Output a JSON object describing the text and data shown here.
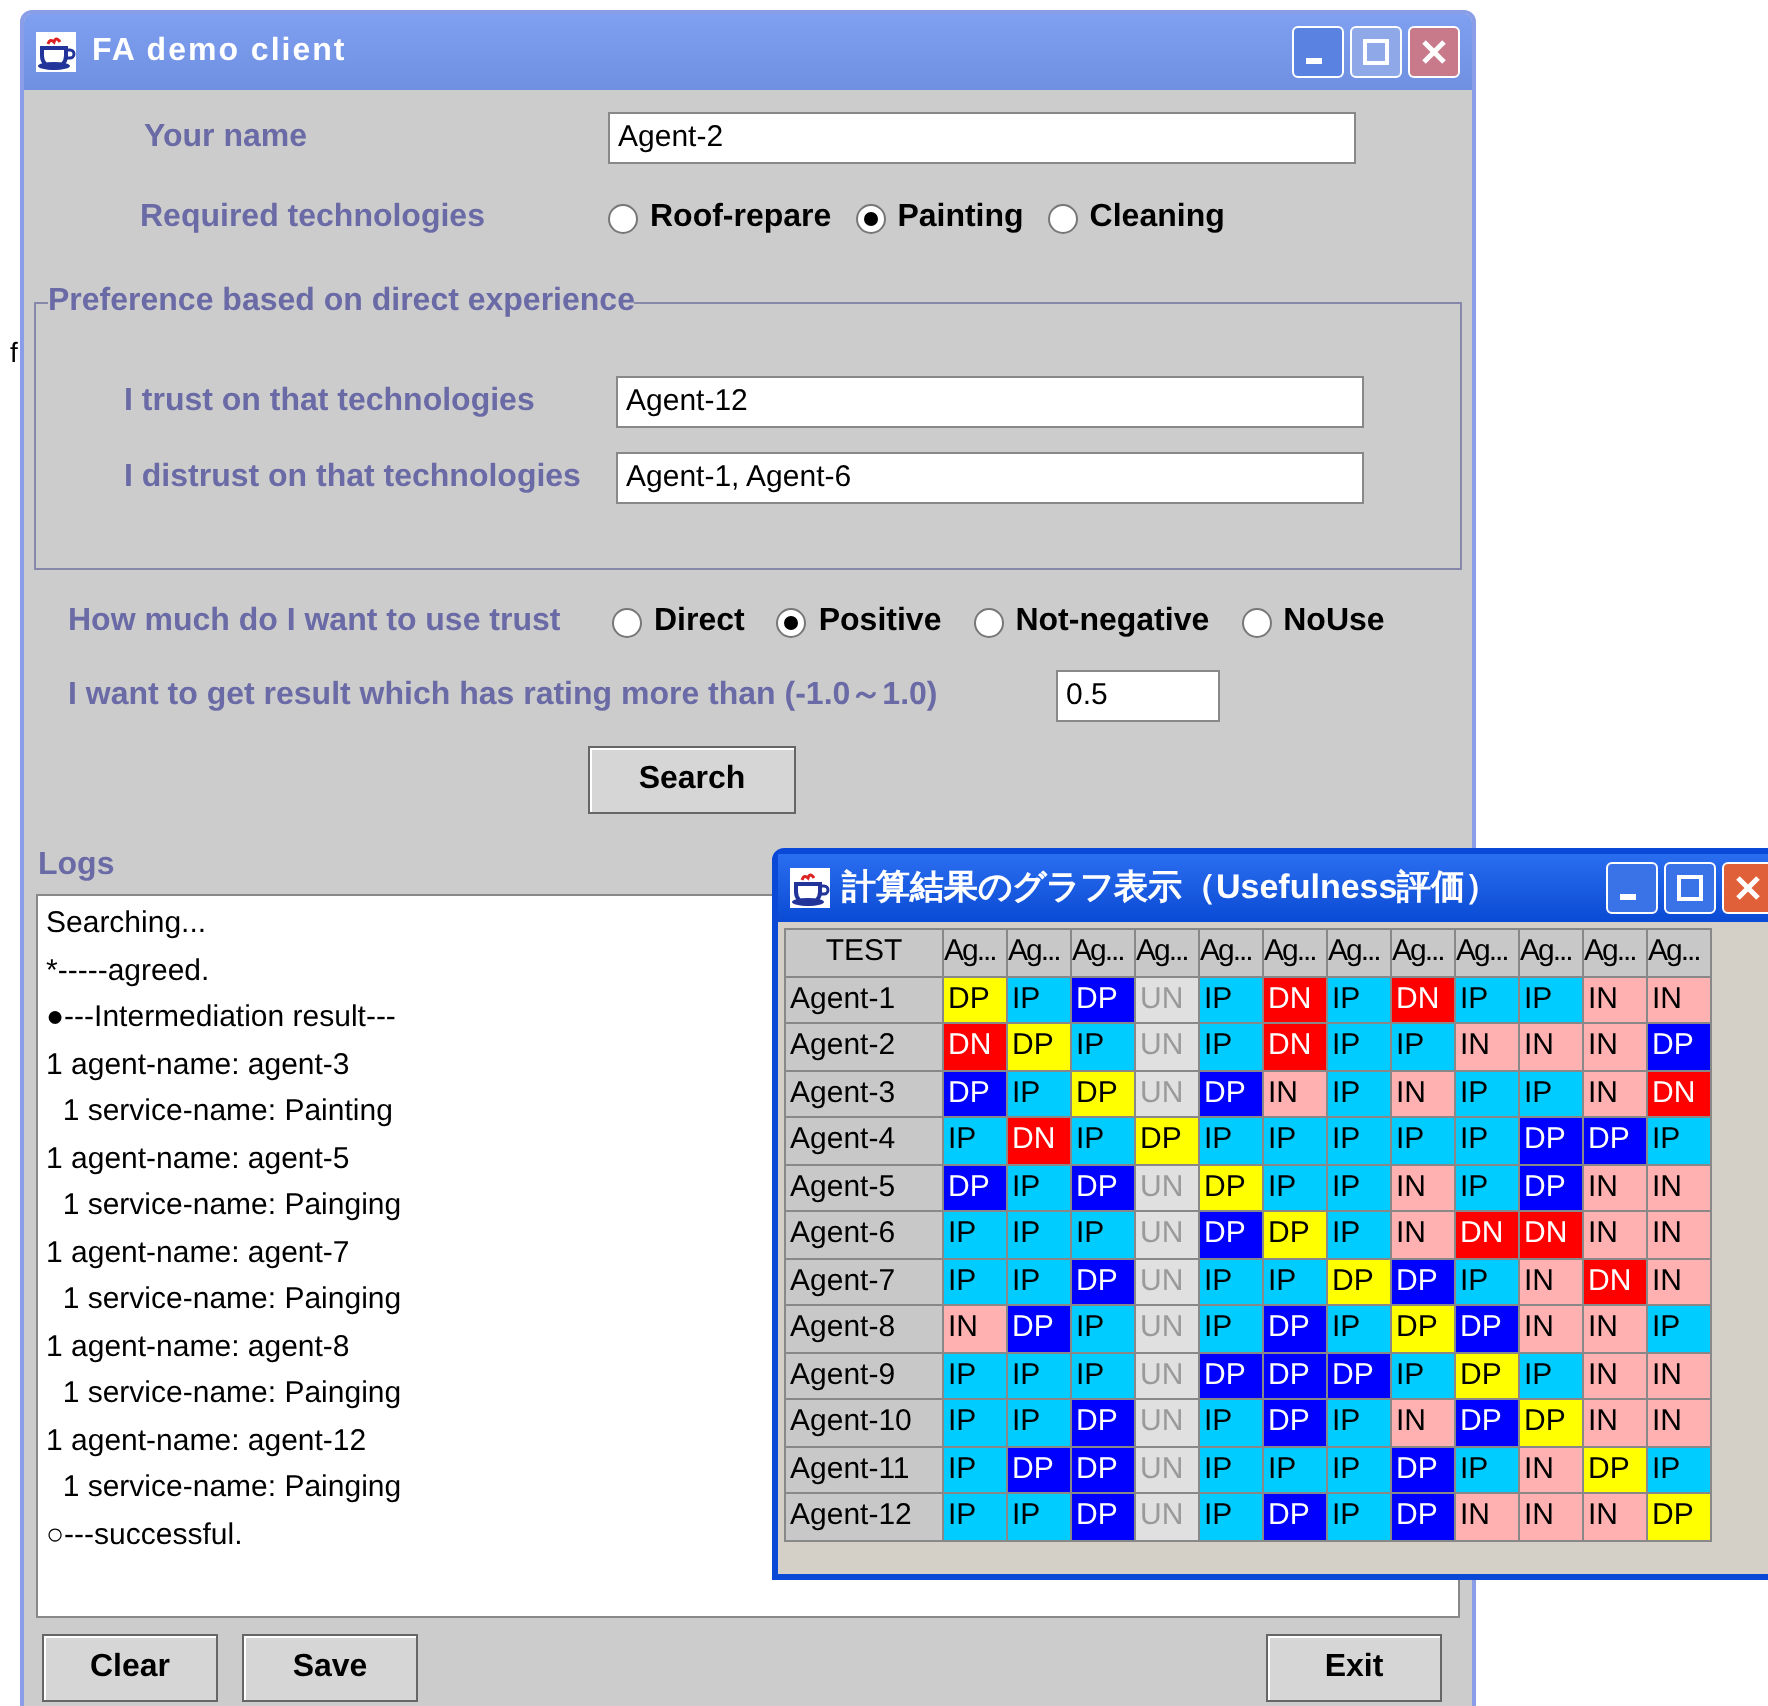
{
  "stray_text": "f",
  "main_window": {
    "title": "FA demo client",
    "your_name": {
      "label": "Your name",
      "value": "Agent-2"
    },
    "required_technologies": {
      "label": "Required technologies",
      "options": [
        {
          "label": "Roof-repare",
          "selected": false
        },
        {
          "label": "Painting",
          "selected": true
        },
        {
          "label": "Cleaning",
          "selected": false
        }
      ]
    },
    "preference_group": {
      "title": "Preference based on direct experience",
      "trust": {
        "label": "I trust on that technologies",
        "value": "Agent-12"
      },
      "distrust": {
        "label": "I distrust on that technologies",
        "value": "Agent-1, Agent-6"
      }
    },
    "trust_usage": {
      "label": "How much do I want to use trust",
      "options": [
        {
          "label": "Direct",
          "selected": false
        },
        {
          "label": "Positive",
          "selected": true
        },
        {
          "label": "Not-negative",
          "selected": false
        },
        {
          "label": "NoUse",
          "selected": false
        }
      ]
    },
    "rating": {
      "label": "I want to get result which has rating more than (-1.0～1.0)",
      "value": "0.5"
    },
    "search_button": "Search",
    "logs": {
      "label": "Logs",
      "lines": [
        "Searching...",
        "*-----agreed.",
        "●---Intermediation result---",
        "1 agent-name: agent-3",
        "  1 service-name: Painting",
        "1 agent-name: agent-5",
        "  1 service-name: Painging",
        "1 agent-name: agent-7",
        "  1 service-name: Painging",
        "1 agent-name: agent-8",
        "  1 service-name: Painging",
        "1 agent-name: agent-12",
        "  1 service-name: Painging",
        "○---successful."
      ]
    },
    "buttons": [
      "Clear",
      "Save",
      "Exit"
    ]
  },
  "graph_window": {
    "title": "計算結果のグラフ表示（Usefulness評価）",
    "table": {
      "corner": "TEST",
      "columns": [
        "Ag...",
        "Ag...",
        "Ag...",
        "Ag...",
        "Ag...",
        "Ag...",
        "Ag...",
        "Ag...",
        "Ag...",
        "Ag...",
        "Ag...",
        "Ag..."
      ],
      "rows": [
        {
          "name": "Agent-1",
          "cells": [
            {
              "text": "DP",
              "color": "#ffff00"
            },
            {
              "text": "IP",
              "color": "#00ccff"
            },
            {
              "text": "DP",
              "color": "#0000ff"
            },
            {
              "text": "UN",
              "color": "#e0e0e0"
            },
            {
              "text": "IP",
              "color": "#00ccff"
            },
            {
              "text": "DN",
              "color": "#ff0000"
            },
            {
              "text": "IP",
              "color": "#00ccff"
            },
            {
              "text": "DN",
              "color": "#ff0000"
            },
            {
              "text": "IP",
              "color": "#00ccff"
            },
            {
              "text": "IP",
              "color": "#00ccff"
            },
            {
              "text": "IN",
              "color": "#ffb0b0"
            },
            {
              "text": "IN",
              "color": "#ffb0b0"
            }
          ]
        },
        {
          "name": "Agent-2",
          "cells": [
            {
              "text": "DN",
              "color": "#ff0000"
            },
            {
              "text": "DP",
              "color": "#ffff00"
            },
            {
              "text": "IP",
              "color": "#00ccff"
            },
            {
              "text": "UN",
              "color": "#e0e0e0"
            },
            {
              "text": "IP",
              "color": "#00ccff"
            },
            {
              "text": "DN",
              "color": "#ff0000"
            },
            {
              "text": "IP",
              "color": "#00ccff"
            },
            {
              "text": "IP",
              "color": "#00ccff"
            },
            {
              "text": "IN",
              "color": "#ffb0b0"
            },
            {
              "text": "IN",
              "color": "#ffb0b0"
            },
            {
              "text": "IN",
              "color": "#ffb0b0"
            },
            {
              "text": "DP",
              "color": "#0000ff"
            }
          ]
        },
        {
          "name": "Agent-3",
          "cells": [
            {
              "text": "DP",
              "color": "#0000ff"
            },
            {
              "text": "IP",
              "color": "#00ccff"
            },
            {
              "text": "DP",
              "color": "#ffff00"
            },
            {
              "text": "UN",
              "color": "#e0e0e0"
            },
            {
              "text": "DP",
              "color": "#0000ff"
            },
            {
              "text": "IN",
              "color": "#ffb0b0"
            },
            {
              "text": "IP",
              "color": "#00ccff"
            },
            {
              "text": "IN",
              "color": "#ffb0b0"
            },
            {
              "text": "IP",
              "color": "#00ccff"
            },
            {
              "text": "IP",
              "color": "#00ccff"
            },
            {
              "text": "IN",
              "color": "#ffb0b0"
            },
            {
              "text": "DN",
              "color": "#ff0000"
            }
          ]
        },
        {
          "name": "Agent-4",
          "cells": [
            {
              "text": "IP",
              "color": "#00ccff"
            },
            {
              "text": "DN",
              "color": "#ff0000"
            },
            {
              "text": "IP",
              "color": "#00ccff"
            },
            {
              "text": "DP",
              "color": "#ffff00"
            },
            {
              "text": "IP",
              "color": "#00ccff"
            },
            {
              "text": "IP",
              "color": "#00ccff"
            },
            {
              "text": "IP",
              "color": "#00ccff"
            },
            {
              "text": "IP",
              "color": "#00ccff"
            },
            {
              "text": "IP",
              "color": "#00ccff"
            },
            {
              "text": "DP",
              "color": "#0000ff"
            },
            {
              "text": "DP",
              "color": "#0000ff"
            },
            {
              "text": "IP",
              "color": "#00ccff"
            }
          ]
        },
        {
          "name": "Agent-5",
          "cells": [
            {
              "text": "DP",
              "color": "#0000ff"
            },
            {
              "text": "IP",
              "color": "#00ccff"
            },
            {
              "text": "DP",
              "color": "#0000ff"
            },
            {
              "text": "UN",
              "color": "#e0e0e0"
            },
            {
              "text": "DP",
              "color": "#ffff00"
            },
            {
              "text": "IP",
              "color": "#00ccff"
            },
            {
              "text": "IP",
              "color": "#00ccff"
            },
            {
              "text": "IN",
              "color": "#ffb0b0"
            },
            {
              "text": "IP",
              "color": "#00ccff"
            },
            {
              "text": "DP",
              "color": "#0000ff"
            },
            {
              "text": "IN",
              "color": "#ffb0b0"
            },
            {
              "text": "IN",
              "color": "#ffb0b0"
            }
          ]
        },
        {
          "name": "Agent-6",
          "cells": [
            {
              "text": "IP",
              "color": "#00ccff"
            },
            {
              "text": "IP",
              "color": "#00ccff"
            },
            {
              "text": "IP",
              "color": "#00ccff"
            },
            {
              "text": "UN",
              "color": "#e0e0e0"
            },
            {
              "text": "DP",
              "color": "#0000ff"
            },
            {
              "text": "DP",
              "color": "#ffff00"
            },
            {
              "text": "IP",
              "color": "#00ccff"
            },
            {
              "text": "IN",
              "color": "#ffb0b0"
            },
            {
              "text": "DN",
              "color": "#ff0000"
            },
            {
              "text": "DN",
              "color": "#ff0000"
            },
            {
              "text": "IN",
              "color": "#ffb0b0"
            },
            {
              "text": "IN",
              "color": "#ffb0b0"
            }
          ]
        },
        {
          "name": "Agent-7",
          "cells": [
            {
              "text": "IP",
              "color": "#00ccff"
            },
            {
              "text": "IP",
              "color": "#00ccff"
            },
            {
              "text": "DP",
              "color": "#0000ff"
            },
            {
              "text": "UN",
              "color": "#e0e0e0"
            },
            {
              "text": "IP",
              "color": "#00ccff"
            },
            {
              "text": "IP",
              "color": "#00ccff"
            },
            {
              "text": "DP",
              "color": "#ffff00"
            },
            {
              "text": "DP",
              "color": "#0000ff"
            },
            {
              "text": "IP",
              "color": "#00ccff"
            },
            {
              "text": "IN",
              "color": "#ffb0b0"
            },
            {
              "text": "DN",
              "color": "#ff0000"
            },
            {
              "text": "IN",
              "color": "#ffb0b0"
            }
          ]
        },
        {
          "name": "Agent-8",
          "cells": [
            {
              "text": "IN",
              "color": "#ffb0b0"
            },
            {
              "text": "DP",
              "color": "#0000ff"
            },
            {
              "text": "IP",
              "color": "#00ccff"
            },
            {
              "text": "UN",
              "color": "#e0e0e0"
            },
            {
              "text": "IP",
              "color": "#00ccff"
            },
            {
              "text": "DP",
              "color": "#0000ff"
            },
            {
              "text": "IP",
              "color": "#00ccff"
            },
            {
              "text": "DP",
              "color": "#ffff00"
            },
            {
              "text": "DP",
              "color": "#0000ff"
            },
            {
              "text": "IN",
              "color": "#ffb0b0"
            },
            {
              "text": "IN",
              "color": "#ffb0b0"
            },
            {
              "text": "IP",
              "color": "#00ccff"
            }
          ]
        },
        {
          "name": "Agent-9",
          "cells": [
            {
              "text": "IP",
              "color": "#00ccff"
            },
            {
              "text": "IP",
              "color": "#00ccff"
            },
            {
              "text": "IP",
              "color": "#00ccff"
            },
            {
              "text": "UN",
              "color": "#e0e0e0"
            },
            {
              "text": "DP",
              "color": "#0000ff"
            },
            {
              "text": "DP",
              "color": "#0000ff"
            },
            {
              "text": "DP",
              "color": "#0000ff"
            },
            {
              "text": "IP",
              "color": "#00ccff"
            },
            {
              "text": "DP",
              "color": "#ffff00"
            },
            {
              "text": "IP",
              "color": "#00ccff"
            },
            {
              "text": "IN",
              "color": "#ffb0b0"
            },
            {
              "text": "IN",
              "color": "#ffb0b0"
            }
          ]
        },
        {
          "name": "Agent-10",
          "cells": [
            {
              "text": "IP",
              "color": "#00ccff"
            },
            {
              "text": "IP",
              "color": "#00ccff"
            },
            {
              "text": "DP",
              "color": "#0000ff"
            },
            {
              "text": "UN",
              "color": "#e0e0e0"
            },
            {
              "text": "IP",
              "color": "#00ccff"
            },
            {
              "text": "DP",
              "color": "#0000ff"
            },
            {
              "text": "IP",
              "color": "#00ccff"
            },
            {
              "text": "IN",
              "color": "#ffb0b0"
            },
            {
              "text": "DP",
              "color": "#0000ff"
            },
            {
              "text": "DP",
              "color": "#ffff00"
            },
            {
              "text": "IN",
              "color": "#ffb0b0"
            },
            {
              "text": "IN",
              "color": "#ffb0b0"
            }
          ]
        },
        {
          "name": "Agent-11",
          "cells": [
            {
              "text": "IP",
              "color": "#00ccff"
            },
            {
              "text": "DP",
              "color": "#0000ff"
            },
            {
              "text": "DP",
              "color": "#0000ff"
            },
            {
              "text": "UN",
              "color": "#e0e0e0"
            },
            {
              "text": "IP",
              "color": "#00ccff"
            },
            {
              "text": "IP",
              "color": "#00ccff"
            },
            {
              "text": "IP",
              "color": "#00ccff"
            },
            {
              "text": "DP",
              "color": "#0000ff"
            },
            {
              "text": "IP",
              "color": "#00ccff"
            },
            {
              "text": "IN",
              "color": "#ffb0b0"
            },
            {
              "text": "DP",
              "color": "#ffff00"
            },
            {
              "text": "IP",
              "color": "#00ccff"
            }
          ]
        },
        {
          "name": "Agent-12",
          "cells": [
            {
              "text": "IP",
              "color": "#00ccff"
            },
            {
              "text": "IP",
              "color": "#00ccff"
            },
            {
              "text": "DP",
              "color": "#0000ff"
            },
            {
              "text": "UN",
              "color": "#e0e0e0"
            },
            {
              "text": "IP",
              "color": "#00ccff"
            },
            {
              "text": "DP",
              "color": "#0000ff"
            },
            {
              "text": "IP",
              "color": "#00ccff"
            },
            {
              "text": "DP",
              "color": "#0000ff"
            },
            {
              "text": "IN",
              "color": "#ffb0b0"
            },
            {
              "text": "IN",
              "color": "#ffb0b0"
            },
            {
              "text": "IN",
              "color": "#ffb0b0"
            },
            {
              "text": "DP",
              "color": "#ffff00"
            }
          ]
        }
      ]
    }
  }
}
